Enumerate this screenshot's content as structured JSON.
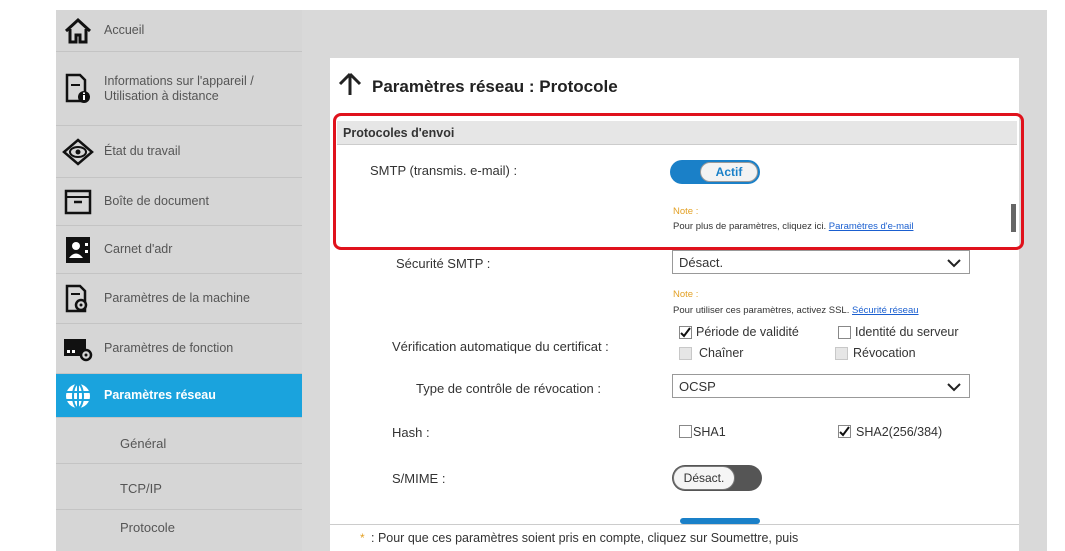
{
  "sidebar": {
    "items": [
      {
        "label": "Accueil",
        "icon": "home-icon"
      },
      {
        "label": "Informations sur l'appareil / Utilisation à distance",
        "icon": "device-info-icon"
      },
      {
        "label": "État du travail",
        "icon": "eye-icon"
      },
      {
        "label": "Boîte de document",
        "icon": "document-box-icon"
      },
      {
        "label": "Carnet d'adr",
        "icon": "address-book-icon"
      },
      {
        "label": "Paramètres de la machine",
        "icon": "machine-settings-icon"
      },
      {
        "label": "Paramètres de fonction",
        "icon": "function-settings-icon"
      },
      {
        "label": "Paramètres réseau",
        "icon": "globe-icon",
        "active": true
      }
    ],
    "sub_items": [
      "Général",
      "TCP/IP",
      "Protocole"
    ]
  },
  "page": {
    "title": "Paramètres réseau : Protocole"
  },
  "section": {
    "title": "Protocoles d'envoi"
  },
  "smtp": {
    "label": "SMTP (transmis. e-mail) :",
    "toggle": "Actif",
    "note_title": "Note :",
    "note_text": "Pour plus de paramètres, cliquez ici. ",
    "note_link": "Paramètres d'e-mail"
  },
  "smtp_security": {
    "label": "Sécurité SMTP :",
    "value": "Désact.",
    "note_title": "Note :",
    "note_text": "Pour utiliser ces paramètres, activez SSL. ",
    "note_link": "Sécurité réseau"
  },
  "cert_check": {
    "label": "Vérification automatique du certificat :",
    "options": [
      {
        "label": "Période de validité",
        "checked": true,
        "enabled": true
      },
      {
        "label": "Identité du serveur",
        "checked": false,
        "enabled": true
      },
      {
        "label": "Chaîner",
        "checked": false,
        "enabled": false
      },
      {
        "label": "Révocation",
        "checked": false,
        "enabled": false
      }
    ]
  },
  "revocation_type": {
    "label": "Type de contrôle de révocation :",
    "value": "OCSP"
  },
  "hash": {
    "label": "Hash :",
    "options": [
      {
        "label": "SHA1",
        "checked": false
      },
      {
        "label": "SHA2(256/384)",
        "checked": true
      }
    ]
  },
  "smime": {
    "label": "S/MIME :",
    "toggle": "Désact."
  },
  "footer": {
    "star": "*",
    "text": ": Pour que ces paramètres soient pris en compte, cliquez sur Soumettre, puis"
  },
  "colors": {
    "accent": "#1aa3dd",
    "toggle_on": "#1a80c8",
    "highlight": "#e0121c",
    "note": "#e3a126"
  }
}
